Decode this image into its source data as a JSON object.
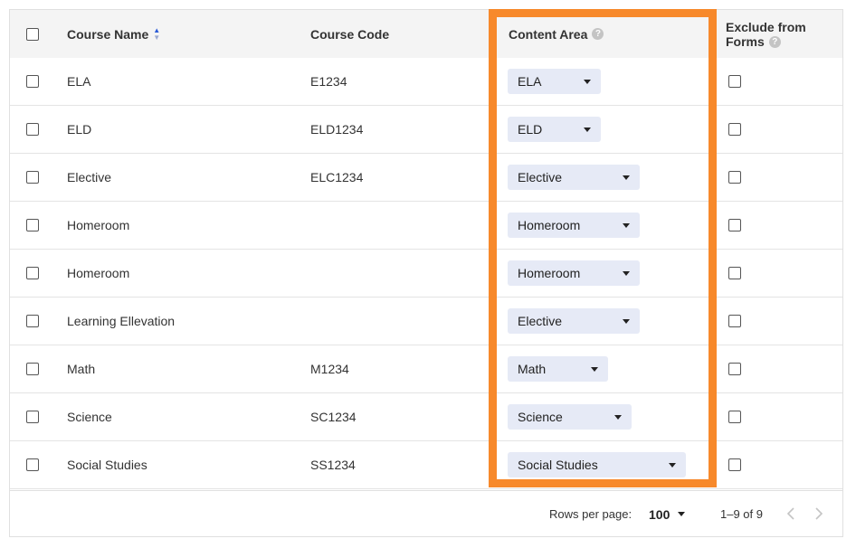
{
  "columns": {
    "course_name": "Course Name",
    "course_code": "Course Code",
    "content_area": "Content Area",
    "exclude_line1": "Exclude from",
    "exclude_line2": "Forms"
  },
  "rows": [
    {
      "name": "ELA",
      "code": "E1234",
      "area": "ELA"
    },
    {
      "name": "ELD",
      "code": "ELD1234",
      "area": "ELD"
    },
    {
      "name": "Elective",
      "code": "ELC1234",
      "area": "Elective"
    },
    {
      "name": "Homeroom",
      "code": "",
      "area": "Homeroom"
    },
    {
      "name": "Homeroom",
      "code": "",
      "area": "Homeroom"
    },
    {
      "name": "Learning Ellevation",
      "code": "",
      "area": "Elective"
    },
    {
      "name": "Math",
      "code": "M1234",
      "area": "Math"
    },
    {
      "name": "Science",
      "code": "SC1234",
      "area": "Science"
    },
    {
      "name": "Social Studies",
      "code": "SS1234",
      "area": "Social Studies"
    }
  ],
  "footer": {
    "rows_per_page_label": "Rows per page:",
    "rows_per_page_value": "100",
    "range": "1–9 of 9"
  },
  "icons": {
    "help": "question-circle-icon",
    "sort": "sort-ascending-icon",
    "dropdown": "caret-down-icon",
    "prev": "chevron-left-icon",
    "next": "chevron-right-icon"
  },
  "colors": {
    "highlight": "#f7892b",
    "select_bg": "#e6eaf6",
    "header_bg": "#f4f4f4"
  }
}
